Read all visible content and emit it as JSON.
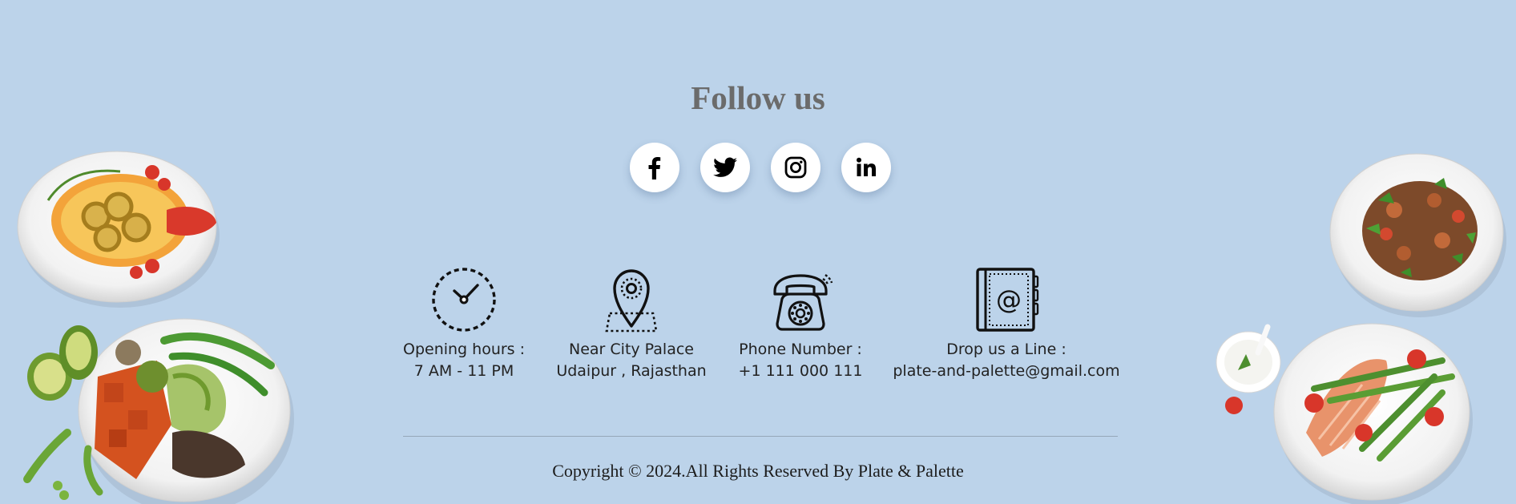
{
  "follow": {
    "title": "Follow us",
    "socials": [
      {
        "name": "facebook-icon"
      },
      {
        "name": "twitter-icon"
      },
      {
        "name": "instagram-icon"
      },
      {
        "name": "linkedin-icon"
      }
    ]
  },
  "contact": [
    {
      "icon": "clock-icon",
      "label": "Opening hours :",
      "value": "7 AM - 11 PM"
    },
    {
      "icon": "location-pin-icon",
      "label": "Near City Palace",
      "value": "Udaipur , Rajasthan"
    },
    {
      "icon": "telephone-icon",
      "label": "Phone Number :",
      "value": "+1 111 000 111"
    },
    {
      "icon": "address-book-icon",
      "label": "Drop us a Line :",
      "value": "plate-and-palette@gmail.com"
    }
  ],
  "footer": {
    "copyright": "Copyright © 2024.All Rights Reserved By Plate & Palette"
  },
  "colors": {
    "background": "#bcd3ea",
    "title": "#6b6b6b",
    "text": "#222222"
  }
}
